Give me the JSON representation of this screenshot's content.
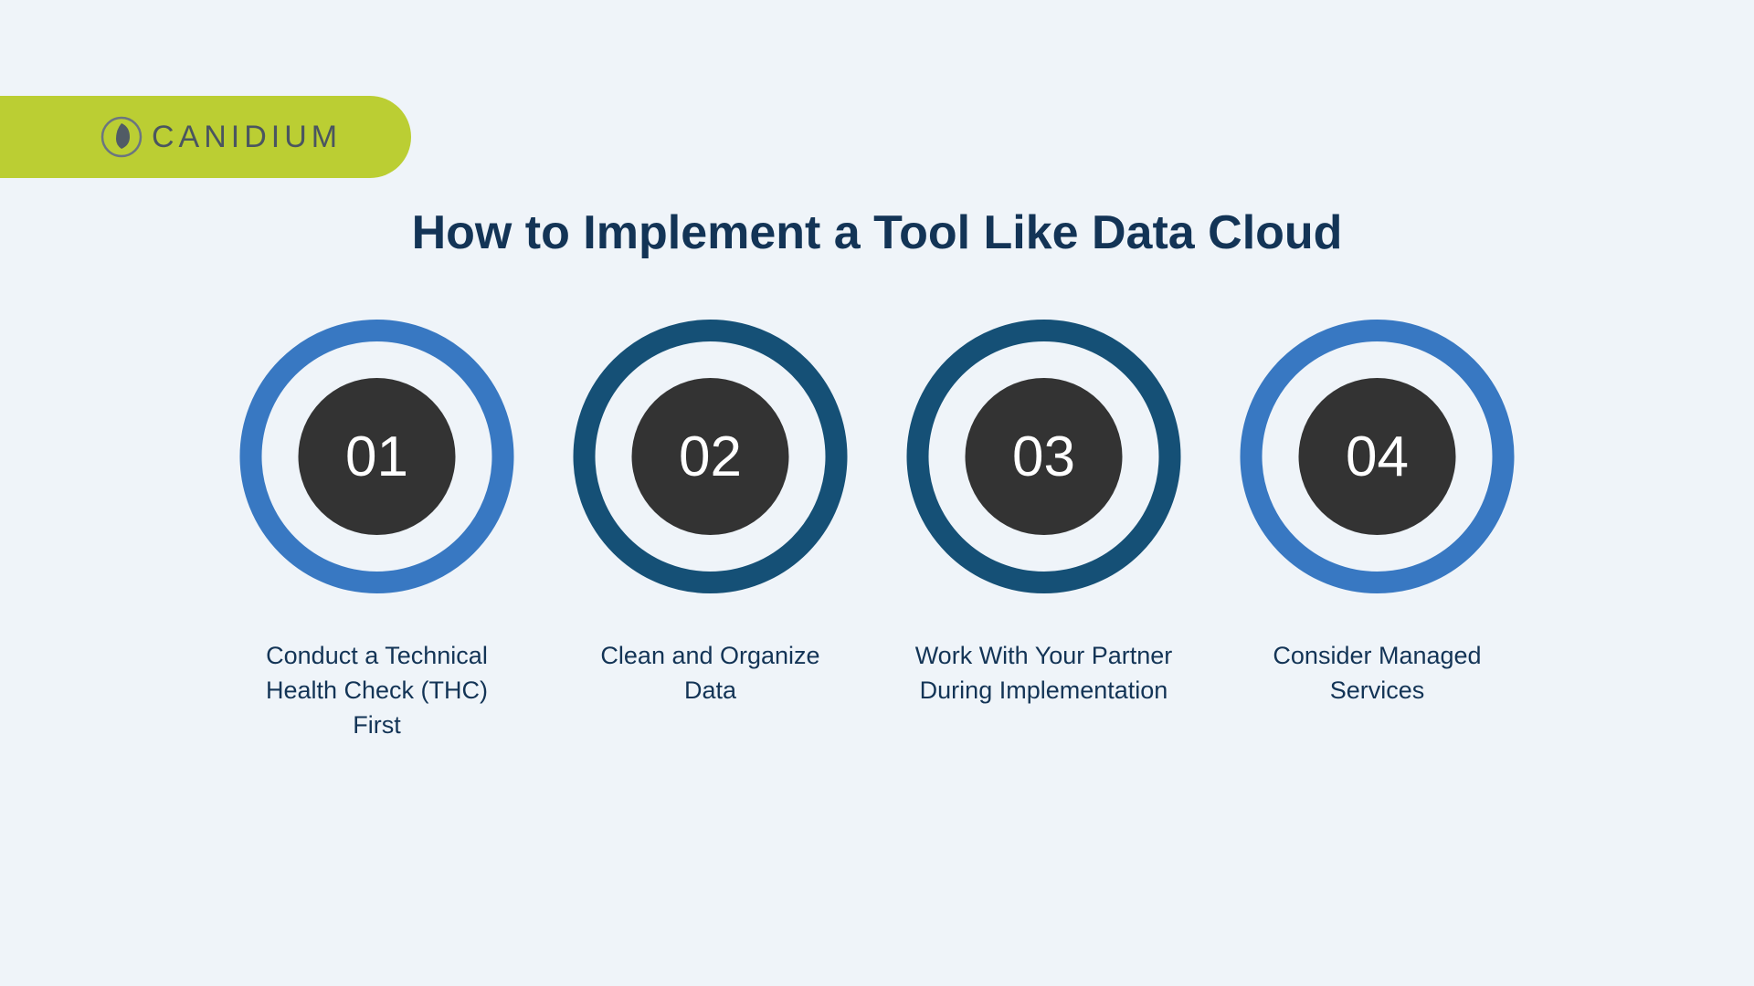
{
  "brand": {
    "name": "CANIDIUM",
    "pillColor": "#bbce33",
    "iconRingColor": "#6b7580",
    "iconLeafColor": "#515b65"
  },
  "title": "How to Implement a Tool Like Data Cloud",
  "colors": {
    "background": "#eff4f9",
    "titleText": "#133456",
    "labelText": "#133456",
    "ringBlue": "#3878c2",
    "ringDark": "#155076",
    "innerCircle": "#333333",
    "numberText": "#ffffff"
  },
  "steps": [
    {
      "number": "01",
      "label": "Conduct a Technical Health Check (THC) First",
      "ringStyle": "blue"
    },
    {
      "number": "02",
      "label": "Clean and Organize Data",
      "ringStyle": "dark"
    },
    {
      "number": "03",
      "label": "Work With Your Partner During Implementation",
      "ringStyle": "dark"
    },
    {
      "number": "04",
      "label": "Consider Managed Services",
      "ringStyle": "blue"
    }
  ]
}
